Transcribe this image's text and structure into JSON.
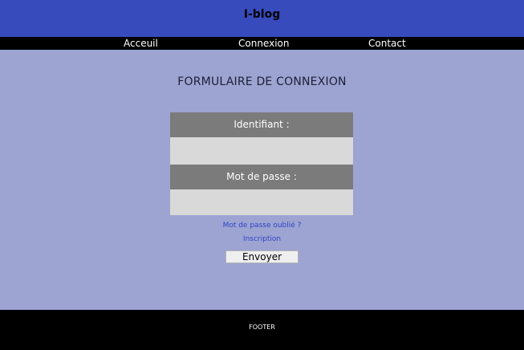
{
  "header": {
    "brand": "I-blog",
    "background": "#374bbd"
  },
  "nav": {
    "items": [
      "Acceuil",
      "Connexion",
      "Contact"
    ]
  },
  "main": {
    "title": "FORMULAIRE DE CONNEXION",
    "form": {
      "identifiant_label": "Identifiant :",
      "identifiant_value": "",
      "password_label": "Mot de passe :",
      "password_value": "",
      "forgot_link": "Mot de passe oublié ?",
      "signup_link": "Inscription",
      "submit_label": "Envoyer"
    }
  },
  "footer": {
    "label": "FOOTER"
  },
  "colors": {
    "page_background": "#9da4d2",
    "nav_background": "#000000",
    "label_background": "#7b7b7b",
    "input_background": "#d9d9d9",
    "link": "#2f43c4"
  }
}
